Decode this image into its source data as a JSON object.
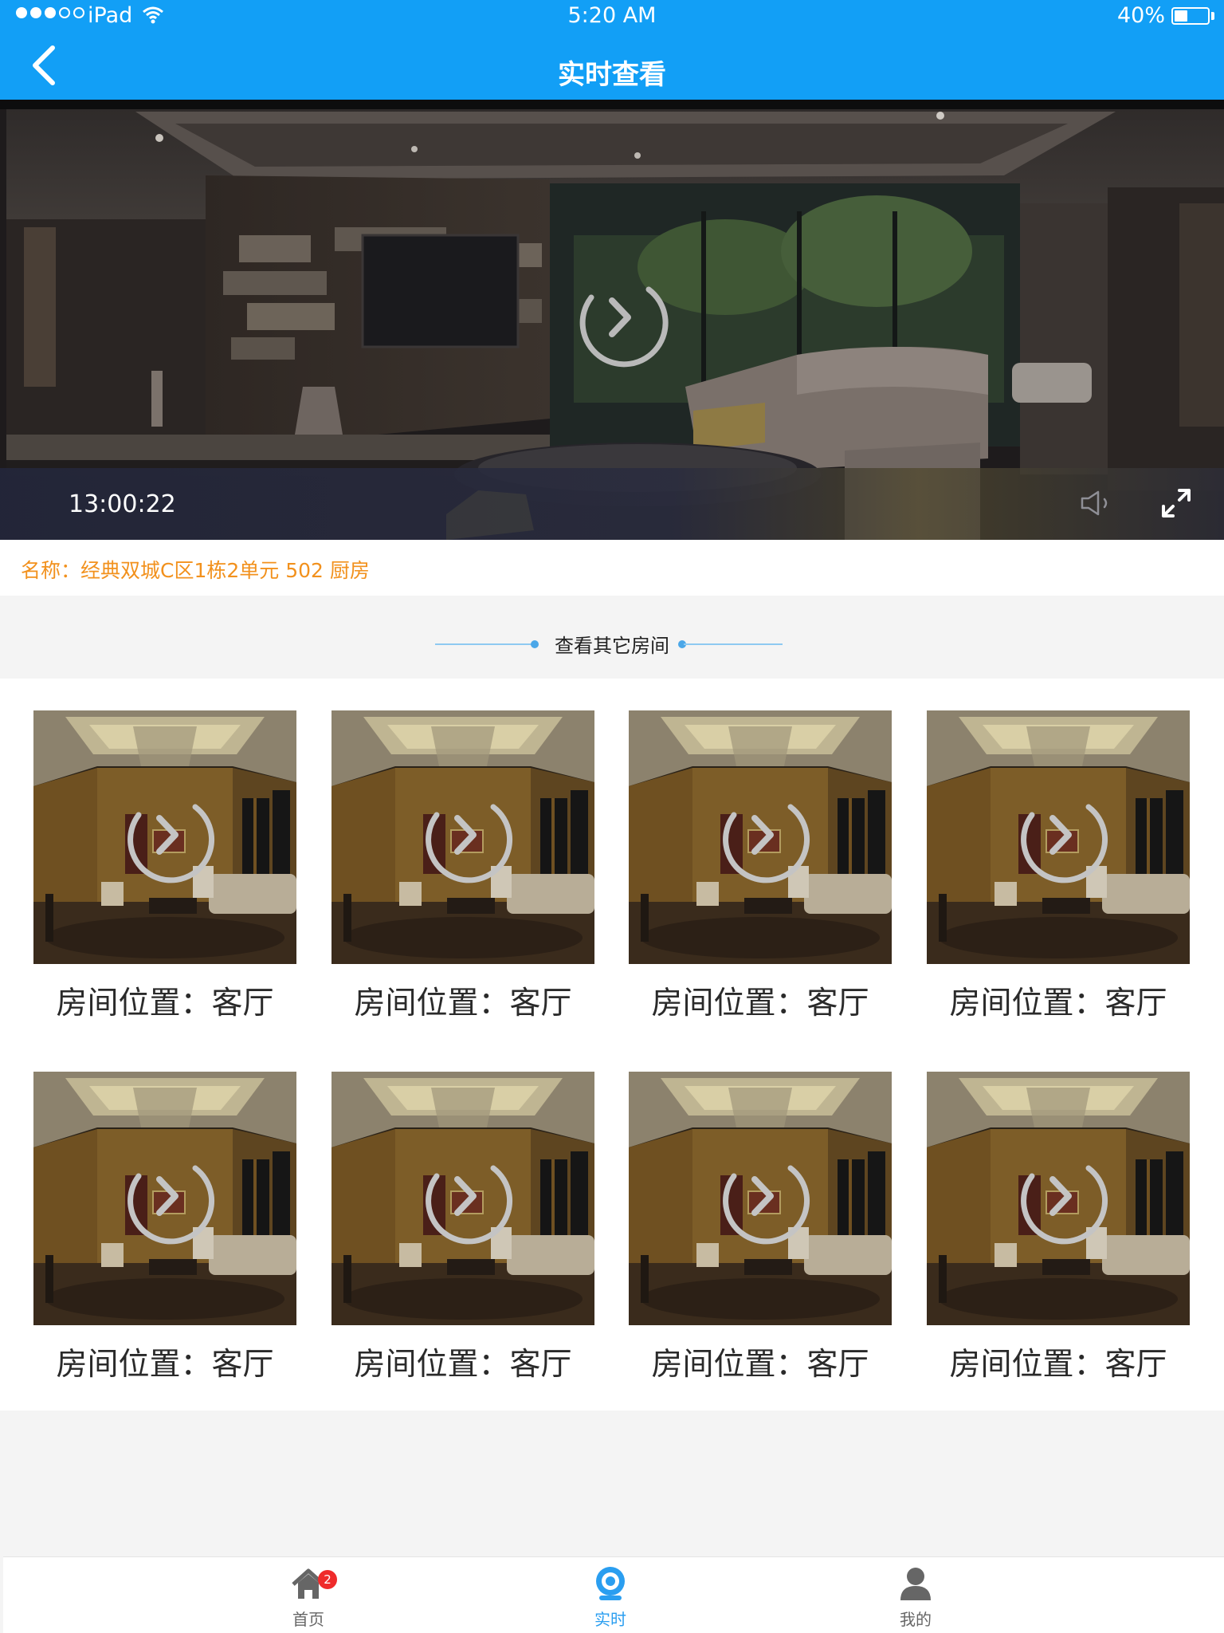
{
  "status_bar": {
    "carrier": "iPad",
    "time": "5:20 AM",
    "battery_percent_text": "40%",
    "battery_level": 0.4
  },
  "nav": {
    "title": "实时查看"
  },
  "player": {
    "timestamp": "13:00:22"
  },
  "camera": {
    "name_label": "名称：经典双城C区1栋2单元 502 厨房"
  },
  "section": {
    "title": "查看其它房间"
  },
  "rooms": [
    {
      "label": "房间位置：客厅"
    },
    {
      "label": "房间位置：客厅"
    },
    {
      "label": "房间位置：客厅"
    },
    {
      "label": "房间位置：客厅"
    },
    {
      "label": "房间位置：客厅"
    },
    {
      "label": "房间位置：客厅"
    },
    {
      "label": "房间位置：客厅"
    },
    {
      "label": "房间位置：客厅"
    }
  ],
  "tabbar": {
    "tabs": [
      {
        "label": "首页",
        "icon": "home-icon",
        "badge": "2"
      },
      {
        "label": "实时",
        "icon": "camera-icon",
        "active": true
      },
      {
        "label": "我的",
        "icon": "user-icon"
      }
    ]
  },
  "colors": {
    "nav_bg": "#129ff6",
    "name_label": "#f2911d",
    "tab_active": "#2a9ef0",
    "badge": "#ef2b2b"
  }
}
